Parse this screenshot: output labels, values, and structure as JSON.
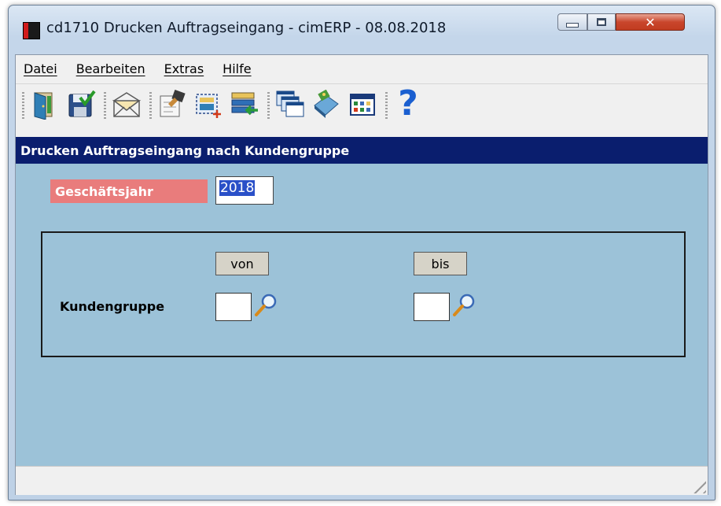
{
  "window": {
    "title": "cd1710 Drucken Auftragseingang - cimERP - 08.08.2018",
    "close_glyph": "✕"
  },
  "menu": [
    {
      "label": "Datei"
    },
    {
      "label": "Bearbeiten"
    },
    {
      "label": "Extras"
    },
    {
      "label": "Hilfe"
    }
  ],
  "toolbar": {
    "icons": [
      "exit-door-icon",
      "save-check-icon",
      "mail-envelope-icon",
      "edit-form-icon",
      "new-selection-icon",
      "list-import-icon",
      "windows-stack-icon",
      "print-book-icon",
      "calendar-grid-icon",
      "help-question-icon"
    ],
    "help_glyph": "?"
  },
  "section": {
    "title": "Drucken Auftragseingang nach Kundengruppe"
  },
  "form": {
    "geschaeftsjahr_label": "Geschäftsjahr",
    "geschaeftsjahr_value": "2018",
    "von_label": "von",
    "bis_label": "bis",
    "kundengruppe_label": "Kundengruppe",
    "kundengruppe_von": "",
    "kundengruppe_bis": ""
  },
  "colors": {
    "section_header_bg": "#0a1e6e",
    "form_bg": "#9cc2d8",
    "required_label_bg": "#e97c7c"
  }
}
